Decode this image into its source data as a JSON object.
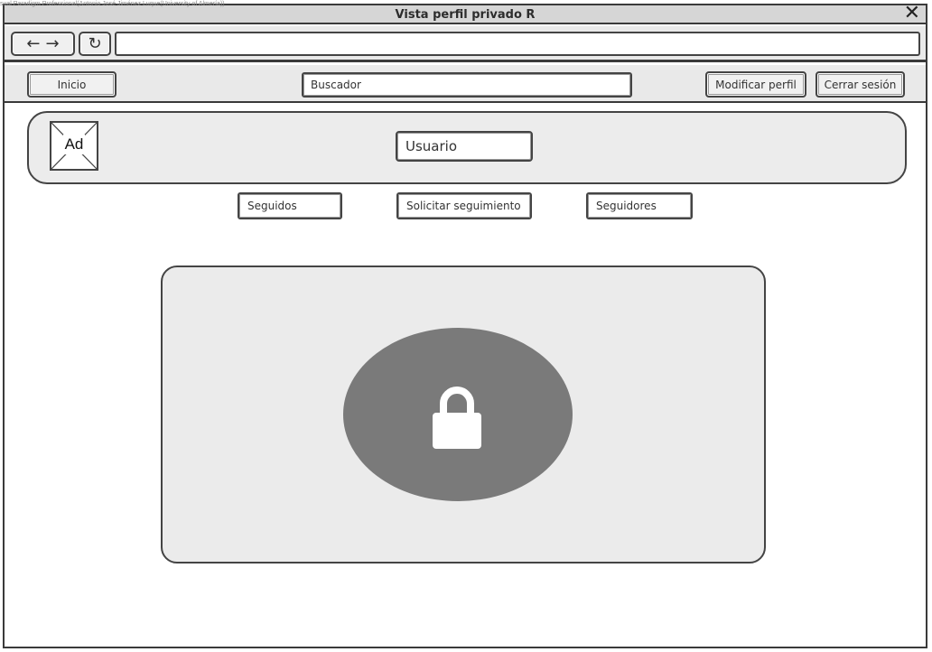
{
  "watermark": "sual Paradigm Professional(Antonio José Jiménez Luque(University of Almería))",
  "window": {
    "title": "Vista perfil privado R",
    "close_glyph": "✕"
  },
  "browser": {
    "back_glyph": "←",
    "forward_glyph": "→",
    "refresh_glyph": "↻",
    "url": ""
  },
  "appbar": {
    "home_label": "Inicio",
    "search_text": "Buscador",
    "edit_profile_label": "Modificar perfil",
    "logout_label": "Cerrar sesión"
  },
  "profile": {
    "image_placeholder": "Ad",
    "username": "Usuario"
  },
  "actions": {
    "following_label": "Seguidos",
    "request_follow_label": "Solicitar seguimiento",
    "followers_label": "Seguidores"
  },
  "private_panel": {
    "icon": "lock-icon",
    "oval_color": "#7a7a7a",
    "panel_color": "#ebebeb"
  }
}
